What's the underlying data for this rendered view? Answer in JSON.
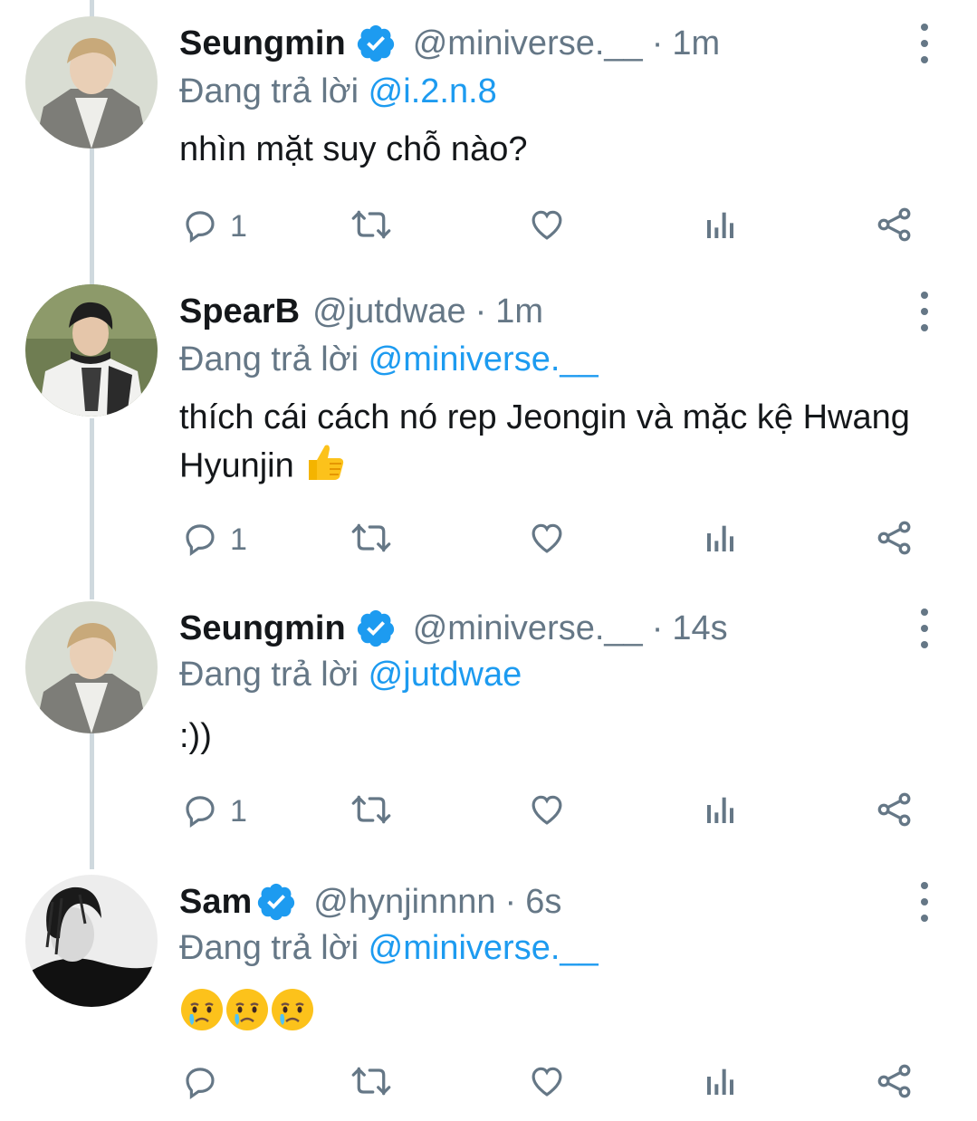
{
  "colors": {
    "text": "#14171a",
    "secondary": "#657786",
    "link": "#1d9bf0",
    "verified": "#1d9bf0",
    "thread_line": "#cfd9de"
  },
  "tweets": [
    {
      "name": "Seungmin",
      "verified": true,
      "handle": "@miniverse.__",
      "separator": "·",
      "time": "1m",
      "reply_prefix": "Đang trả lời",
      "reply_to": "@i.2.n.8",
      "text": "nhìn mặt suy chỗ nào?",
      "replies": "1",
      "avatar": "avatar-seungmin"
    },
    {
      "name": "SpearB",
      "verified": false,
      "handle": "@jutdwae",
      "separator": "·",
      "time": "1m",
      "reply_prefix": "Đang trả lời",
      "reply_to": "@miniverse.__",
      "text": "thích cái cách nó rep Jeongin và mặc kệ Hwang Hyunjin",
      "emoji": "thumbs-up-emoji",
      "replies": "1",
      "avatar": "avatar-spearb"
    },
    {
      "name": "Seungmin",
      "verified": true,
      "handle": "@miniverse.__",
      "separator": "·",
      "time": "14s",
      "reply_prefix": "Đang trả lời",
      "reply_to": "@jutdwae",
      "text": ":))",
      "replies": "1",
      "avatar": "avatar-seungmin"
    },
    {
      "name": "Sam",
      "verified": true,
      "handle": "@hynjinnnn",
      "separator": "·",
      "time": "6s",
      "reply_prefix": "Đang trả lời",
      "reply_to": "@miniverse.__",
      "text": "",
      "emoji": "crying-face-emoji x3",
      "replies": "",
      "avatar": "avatar-sam"
    }
  ],
  "icons": {
    "reply": "reply-icon",
    "retweet": "retweet-icon",
    "like": "heart-icon",
    "analytics": "analytics-icon",
    "share": "share-icon",
    "more": "more-vertical-icon",
    "verified": "verified-badge-icon"
  }
}
